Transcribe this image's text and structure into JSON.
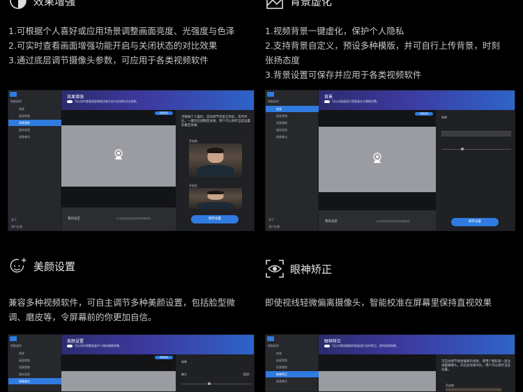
{
  "features": [
    {
      "title": "效果增强",
      "desc": [
        "1.可根据个人喜好或应用场景调整画面亮度、光强度与色泽",
        "2.可实时查看画面增强功能开启与关闭状态的对比效果",
        "3.通过底层调节摄像头参数，可应用于各类视频软件"
      ],
      "icon": "contrast-icon"
    },
    {
      "title": "背景虚化",
      "desc": [
        "1.视频背景一键虚化，保护个人隐私",
        "2.支持背景自定义，预设多种模版，并可自行上传背景，时刻",
        "张扬态度",
        "3.背景设置可保存并应用于各类视频软件"
      ],
      "icon": "background-icon"
    },
    {
      "title": "美颜设置",
      "desc": [
        "兼容多种视频软件，可自主调节多种美颜设置，包括脸型微",
        "调、磨皮等，令屏幕前的你更加自信。"
      ],
      "icon": "smile-plus-icon"
    },
    {
      "title": "眼神矫正",
      "desc": [
        "即使视线轻微偏离摄像头，智能校准在屏幕里保持直视效果"
      ],
      "icon": "eye-icon"
    }
  ],
  "app": {
    "user": "智能画师",
    "nav": [
      "效果",
      "画面增强",
      "背景替换",
      "服务画面",
      "画像美化",
      "眼神矫正"
    ],
    "about": "关于",
    "feedback": "用户反馈",
    "save": "保存设置",
    "my_settings": "我的设定",
    "footer_hint": "点击保存将应用到所有视频软件。",
    "badge": "视频设置",
    "on_label": "开启前",
    "after_label": "开启后",
    "effect_label": "效果",
    "brightness_label": "美白"
  },
  "screens": [
    {
      "title": "效果增强",
      "header_text": "可以实时查看画面增强功能开启与关闭的对比效果。",
      "panel_text": "可根据个人喜好，自动调节亮度与色彩，实时对比，一键开启调整后效果。用户可以保存当前设置的最佳效果。"
    },
    {
      "title": "背景",
      "header_text": "可以对画面进行背景虚化与替换设置。",
      "panel_text": ""
    },
    {
      "title": "美颜设置",
      "header_text": "可以实时调整画面中人物的美颜参数。",
      "panel_text": ""
    },
    {
      "title": "眼神矫正",
      "header_text": "可以对视线偏离的画面进行实时矫正，保持直视效果。",
      "panel_text": "可自动调节视线偏离的视角，使用户看起来一直注视着摄像头。开启后效果对比，用户可以保存当前设置。"
    }
  ],
  "colors": {
    "accent": "#2f7be0",
    "header_start": "#2b2b6e",
    "header_end": "#2e64c8",
    "bg": "#000000"
  }
}
